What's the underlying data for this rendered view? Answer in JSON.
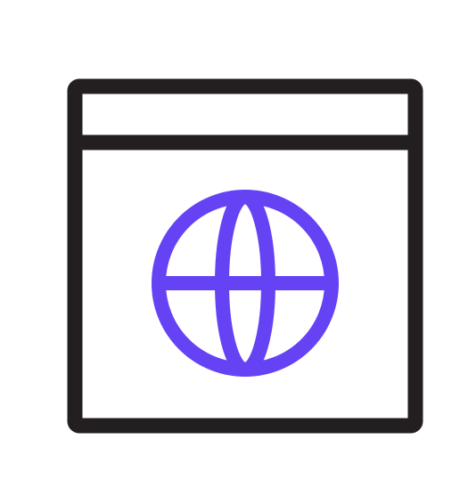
{
  "icon": {
    "name": "browser-globe-icon",
    "parts": {
      "window": "browser-window-icon",
      "globe": "globe-icon"
    }
  },
  "colors": {
    "background": "#ffffff",
    "frame": "#231f20",
    "globe": "#6642f5"
  }
}
